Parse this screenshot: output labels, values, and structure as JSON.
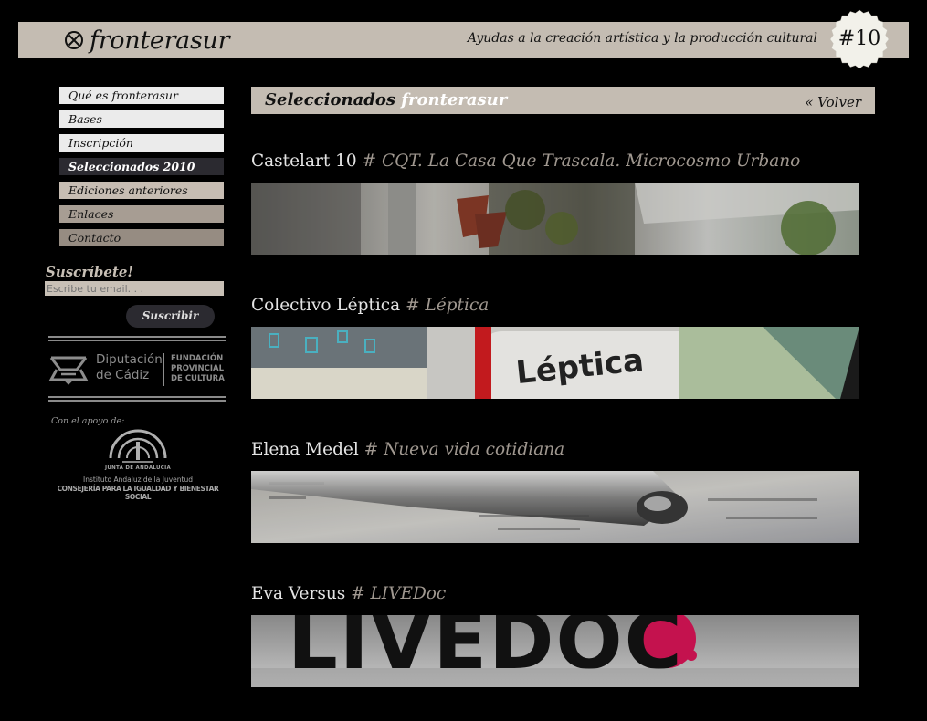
{
  "header": {
    "logo_text": "fronterasur",
    "tagline": "Ayudas a la creación artística y la producción cultural",
    "edition_badge": "#10"
  },
  "nav": {
    "items": [
      {
        "label": "Qué es fronterasur"
      },
      {
        "label": "Bases"
      },
      {
        "label": "Inscripción"
      },
      {
        "label": "Seleccionados 2010"
      },
      {
        "label": "Ediciones anteriores"
      },
      {
        "label": "Enlaces"
      },
      {
        "label": "Contacto"
      }
    ],
    "active_item": "Seleccionados 2010"
  },
  "subscribe": {
    "title": "Suscríbete!",
    "email_placeholder": "Escribe tu email. . .",
    "button_label": "Suscribir"
  },
  "sponsors": {
    "diputacion": {
      "line1": "Diputación",
      "line2": "de Cádiz"
    },
    "fundacion": {
      "line1": "FUNDACIÓN",
      "line2": "PROVINCIAL",
      "line3": "DE CULTURA"
    },
    "apoyo_label": "Con el apoyo de:",
    "junta": {
      "name": "JUNTA DE ANDALUCIA",
      "instituto": "Instituto Andaluz de la Juventud",
      "consejeria": "CONSEJERÍA PARA LA IGUALDAD Y BIENESTAR SOCIAL"
    }
  },
  "main": {
    "title_part1": "Seleccionados ",
    "title_part2": "fronterasur",
    "back_link": "« Volver",
    "entries": [
      {
        "author": "Castelart 10",
        "project": "# CQT. La Casa Que Trascala. Microcosmo Urbano",
        "image": "castelart-photo"
      },
      {
        "author": "Colectivo Léptica",
        "project": "# Léptica",
        "image": "leptica-banner",
        "image_text": "Léptica"
      },
      {
        "author": "Elena Medel",
        "project": "# Nueva vida cotidiana",
        "image": "pen-photo"
      },
      {
        "author": "Eva Versus",
        "project": "# LIVEDoc",
        "image": "livedoc-banner",
        "image_text": "LIVEDOC"
      }
    ]
  },
  "colors": {
    "background": "#000000",
    "header_bar": "#c4bcb2",
    "nav_active": "#2b2a30",
    "project_accent": "#a09890"
  }
}
